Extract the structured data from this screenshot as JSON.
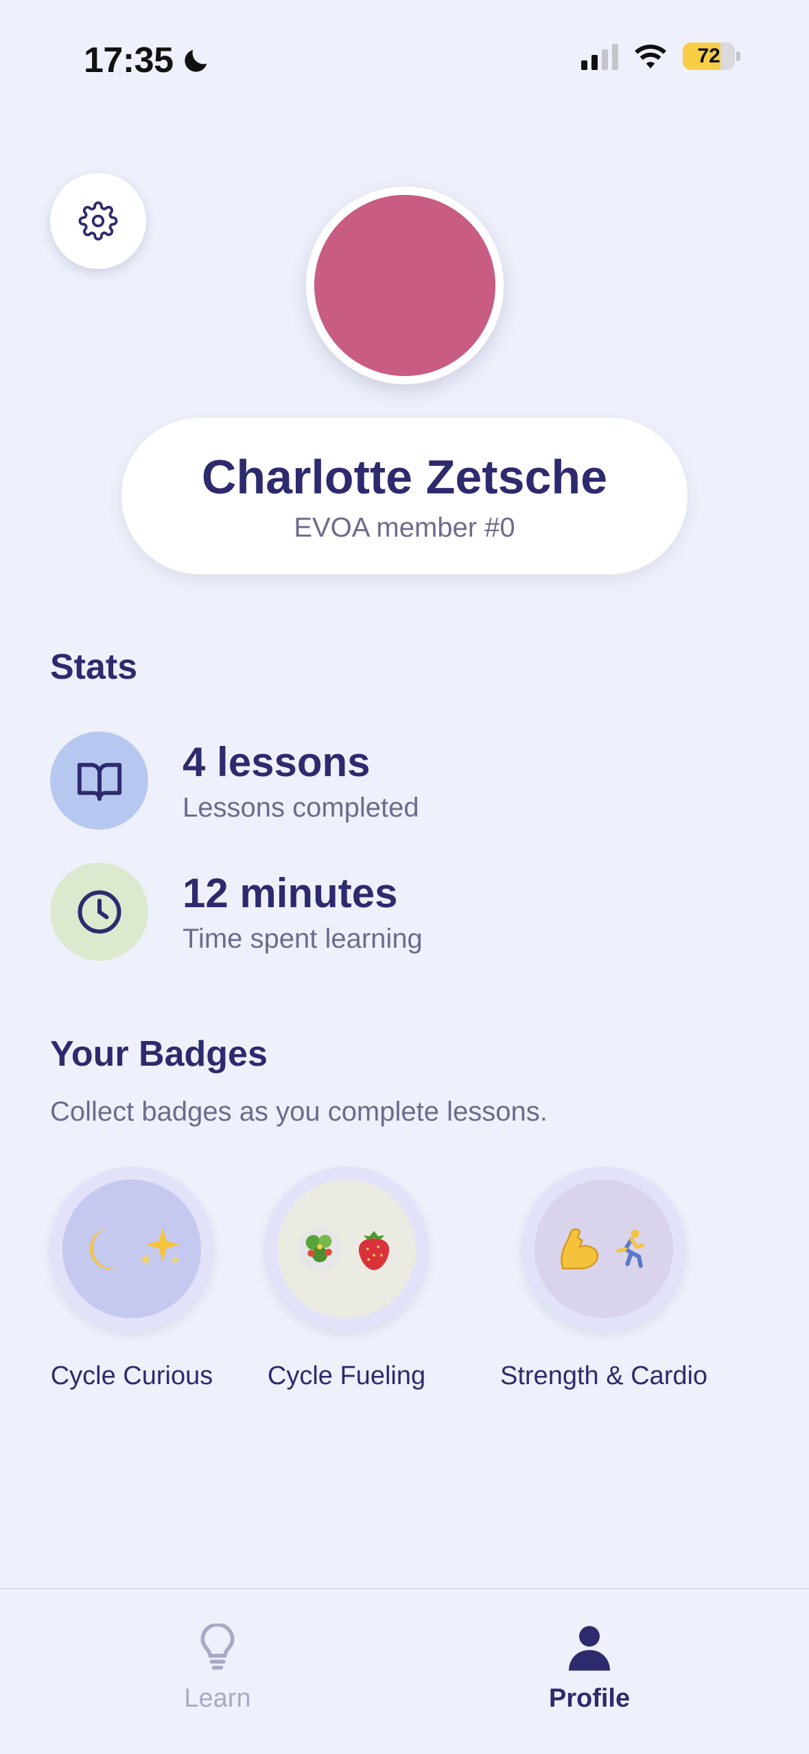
{
  "status_bar": {
    "time": "17:35",
    "battery": "72"
  },
  "profile": {
    "name": "Charlotte Zetsche",
    "member": "EVOA member #0",
    "avatar_color": "#c85c82"
  },
  "stats": {
    "title": "Stats",
    "items": [
      {
        "value": "4 lessons",
        "label": "Lessons completed",
        "icon": "book-open-icon",
        "bg": "#b7c8f0"
      },
      {
        "value": "12 minutes",
        "label": "Time spent learning",
        "icon": "clock-icon",
        "bg": "#dde9cf"
      }
    ]
  },
  "badges": {
    "title": "Your Badges",
    "subtitle": "Collect badges as you complete lessons.",
    "items": [
      {
        "label": "Cycle Curious",
        "emoji": [
          "🌙",
          "✨"
        ]
      },
      {
        "label": "Cycle Fueling",
        "emoji": [
          "🥗",
          "🍓"
        ]
      },
      {
        "label": "Strength & Cardio",
        "emoji": [
          "💪",
          "🏃‍♀️"
        ]
      }
    ]
  },
  "tabs": [
    {
      "label": "Learn",
      "icon": "lightbulb-icon",
      "active": false
    },
    {
      "label": "Profile",
      "icon": "person-icon",
      "active": true
    }
  ],
  "colors": {
    "background": "#eef1fb",
    "primary": "#2e2a6e",
    "muted": "#6c6b8e"
  }
}
